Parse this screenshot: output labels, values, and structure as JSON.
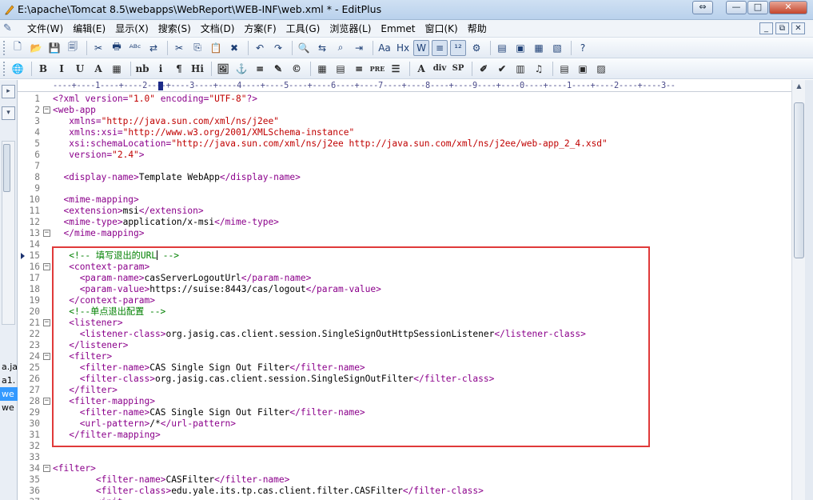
{
  "window": {
    "title": "E:\\apache\\Tomcat 8.5\\webapps\\WebReport\\WEB-INF\\web.xml * - EditPlus",
    "controls": {
      "minimize": "—",
      "maximize": "□",
      "close": "✕"
    },
    "restore_label": "⇔"
  },
  "menu": {
    "items": [
      "文件(W)",
      "编辑(E)",
      "显示(X)",
      "搜索(S)",
      "文档(D)",
      "方案(F)",
      "工具(G)",
      "浏览器(L)",
      "Emmet",
      "窗口(K)",
      "帮助"
    ],
    "mdi": {
      "minimize": "_",
      "restore": "⧉",
      "close": "✕"
    }
  },
  "toolbar1": {
    "icons": [
      "new-file-icon",
      "open-folder-icon",
      "save-icon",
      "save-all-icon",
      "cut-file-icon",
      "print-icon",
      "spellcheck-icon",
      "ftp-icon",
      "cut-icon",
      "copy-icon",
      "paste-icon",
      "delete-icon",
      "undo-icon",
      "redo-icon",
      "find-icon",
      "replace-icon",
      "find-in-files-icon",
      "goto-line-icon",
      "font-size-icon",
      "hex-icon",
      "word-wrap-icon",
      "ruler-icon",
      "line-number-icon",
      "settings-icon",
      "directory-icon",
      "clipboard-icon",
      "output-icon",
      "cliptext-icon",
      "help-icon"
    ],
    "glyphs": [
      "🗋",
      "📂",
      "💾",
      "🗐",
      "✂",
      "🖶",
      "ᴬᴮᶜ",
      "⇄",
      "✂",
      "⎘",
      "📋",
      "✖",
      "↶",
      "↷",
      "🔍",
      "⇆",
      "⌕",
      "⇥",
      "Aa",
      "Hx",
      "W",
      "≡",
      "¹²",
      "⚙",
      "▤",
      "▣",
      "▦",
      "▧",
      "?"
    ]
  },
  "toolbar2": {
    "items": [
      "🌐",
      "B",
      "I",
      "U",
      "A",
      "▦",
      "nb",
      "i",
      "¶",
      "Hi",
      "🖼",
      "⚓",
      "≡",
      "✎",
      "©",
      "▦",
      "▤",
      "≡",
      "PRE",
      "☰",
      "A",
      "div",
      "SP",
      "✐",
      "✔",
      "▥",
      "♫",
      "▤",
      "▣",
      "▨"
    ]
  },
  "left_panel": {
    "buttons": [
      "▸",
      "▾"
    ],
    "files": [
      {
        "name": "a.ja",
        "selected": false
      },
      {
        "name": "a1.",
        "selected": false
      },
      {
        "name": "we",
        "selected": true
      },
      {
        "name": "we",
        "selected": false
      }
    ]
  },
  "ruler": {
    "text": "----+----1----+----2----+----3----+----4----+----5----+----6----+----7----+----8----+----9----+----0----+----1----+----2----+----3--"
  },
  "editor": {
    "lines": [
      {
        "n": "1",
        "fold": "",
        "tokens": [
          [
            "t-tag",
            "<?xml "
          ],
          [
            "t-attr",
            "version="
          ],
          [
            "t-val",
            "\"1.0\" "
          ],
          [
            "t-attr",
            "encoding="
          ],
          [
            "t-val",
            "\"UTF-8\""
          ],
          [
            "t-tag",
            "?>"
          ]
        ]
      },
      {
        "n": "2",
        "fold": "⊟",
        "tokens": [
          [
            "t-tag",
            "<web-app"
          ]
        ]
      },
      {
        "n": "3",
        "fold": "",
        "tokens": [
          [
            "t-text",
            "   "
          ],
          [
            "t-attr",
            "xmlns="
          ],
          [
            "t-val",
            "\"http://java.sun.com/xml/ns/j2ee\""
          ]
        ]
      },
      {
        "n": "4",
        "fold": "",
        "tokens": [
          [
            "t-text",
            "   "
          ],
          [
            "t-attr",
            "xmlns:xsi="
          ],
          [
            "t-val",
            "\"http://www.w3.org/2001/XMLSchema-instance\""
          ]
        ]
      },
      {
        "n": "5",
        "fold": "",
        "tokens": [
          [
            "t-text",
            "   "
          ],
          [
            "t-attr",
            "xsi:schemaLocation="
          ],
          [
            "t-val",
            "\"http://java.sun.com/xml/ns/j2ee http://java.sun.com/xml/ns/j2ee/web-app_2_4.xsd\""
          ]
        ]
      },
      {
        "n": "6",
        "fold": "",
        "tokens": [
          [
            "t-text",
            "   "
          ],
          [
            "t-attr",
            "version="
          ],
          [
            "t-val",
            "\"2.4\""
          ],
          [
            "t-tag",
            ">"
          ]
        ]
      },
      {
        "n": "7",
        "fold": "",
        "tokens": []
      },
      {
        "n": "8",
        "fold": "",
        "tokens": [
          [
            "t-text",
            "  "
          ],
          [
            "t-tag",
            "<display-name>"
          ],
          [
            "t-text",
            "Template WebApp"
          ],
          [
            "t-tag",
            "</display-name>"
          ]
        ]
      },
      {
        "n": "9",
        "fold": "",
        "tokens": []
      },
      {
        "n": "10",
        "fold": "",
        "tokens": [
          [
            "t-text",
            "  "
          ],
          [
            "t-tag",
            "<mime-mapping>"
          ]
        ]
      },
      {
        "n": "11",
        "fold": "",
        "tokens": [
          [
            "t-text",
            "  "
          ],
          [
            "t-tag",
            "<extension>"
          ],
          [
            "t-text",
            "msi"
          ],
          [
            "t-tag",
            "</extension>"
          ]
        ]
      },
      {
        "n": "12",
        "fold": "",
        "tokens": [
          [
            "t-text",
            "  "
          ],
          [
            "t-tag",
            "<mime-type>"
          ],
          [
            "t-text",
            "application/x-msi"
          ],
          [
            "t-tag",
            "</mime-type>"
          ]
        ]
      },
      {
        "n": "13",
        "fold": "⊟",
        "tokens": [
          [
            "t-text",
            "  "
          ],
          [
            "t-tag",
            "</mime-mapping>"
          ]
        ]
      },
      {
        "n": "14",
        "fold": "",
        "tokens": []
      },
      {
        "n": "15",
        "fold": "",
        "marker": true,
        "tokens": [
          [
            "t-text",
            "   "
          ],
          [
            "t-comment",
            "<!-- 填写退出的URL"
          ],
          [
            "caret",
            ""
          ],
          [
            "t-comment",
            " -->"
          ]
        ]
      },
      {
        "n": "16",
        "fold": "⊟",
        "tokens": [
          [
            "t-text",
            "   "
          ],
          [
            "t-tag",
            "<context-param>"
          ]
        ]
      },
      {
        "n": "17",
        "fold": "",
        "tokens": [
          [
            "t-text",
            "     "
          ],
          [
            "t-tag",
            "<param-name>"
          ],
          [
            "t-text",
            "casServerLogoutUrl"
          ],
          [
            "t-tag",
            "</param-name>"
          ]
        ]
      },
      {
        "n": "18",
        "fold": "",
        "tokens": [
          [
            "t-text",
            "     "
          ],
          [
            "t-tag",
            "<param-value>"
          ],
          [
            "t-text",
            "https://suise:8443/cas/logout"
          ],
          [
            "t-tag",
            "</param-value>"
          ]
        ]
      },
      {
        "n": "19",
        "fold": "",
        "tokens": [
          [
            "t-text",
            "   "
          ],
          [
            "t-tag",
            "</context-param>"
          ]
        ]
      },
      {
        "n": "20",
        "fold": "",
        "tokens": [
          [
            "t-text",
            "   "
          ],
          [
            "t-comment",
            "<!--单点退出配置 -->"
          ]
        ]
      },
      {
        "n": "21",
        "fold": "⊟",
        "tokens": [
          [
            "t-text",
            "   "
          ],
          [
            "t-tag",
            "<listener>"
          ]
        ]
      },
      {
        "n": "22",
        "fold": "",
        "tokens": [
          [
            "t-text",
            "     "
          ],
          [
            "t-tag",
            "<listener-class>"
          ],
          [
            "t-text",
            "org.jasig.cas.client.session.SingleSignOutHttpSessionListener"
          ],
          [
            "t-tag",
            "</listener-class>"
          ]
        ]
      },
      {
        "n": "23",
        "fold": "",
        "tokens": [
          [
            "t-text",
            "   "
          ],
          [
            "t-tag",
            "</listener>"
          ]
        ]
      },
      {
        "n": "24",
        "fold": "⊟",
        "tokens": [
          [
            "t-text",
            "   "
          ],
          [
            "t-tag",
            "<filter>"
          ]
        ]
      },
      {
        "n": "25",
        "fold": "",
        "tokens": [
          [
            "t-text",
            "     "
          ],
          [
            "t-tag",
            "<filter-name>"
          ],
          [
            "t-text",
            "CAS Single Sign Out Filter"
          ],
          [
            "t-tag",
            "</filter-name>"
          ]
        ]
      },
      {
        "n": "26",
        "fold": "",
        "tokens": [
          [
            "t-text",
            "     "
          ],
          [
            "t-tag",
            "<filter-class>"
          ],
          [
            "t-text",
            "org.jasig.cas.client.session.SingleSignOutFilter"
          ],
          [
            "t-tag",
            "</filter-class>"
          ]
        ]
      },
      {
        "n": "27",
        "fold": "",
        "tokens": [
          [
            "t-text",
            "   "
          ],
          [
            "t-tag",
            "</filter>"
          ]
        ]
      },
      {
        "n": "28",
        "fold": "⊟",
        "tokens": [
          [
            "t-text",
            "   "
          ],
          [
            "t-tag",
            "<filter-mapping>"
          ]
        ]
      },
      {
        "n": "29",
        "fold": "",
        "tokens": [
          [
            "t-text",
            "     "
          ],
          [
            "t-tag",
            "<filter-name>"
          ],
          [
            "t-text",
            "CAS Single Sign Out Filter"
          ],
          [
            "t-tag",
            "</filter-name>"
          ]
        ]
      },
      {
        "n": "30",
        "fold": "",
        "tokens": [
          [
            "t-text",
            "     "
          ],
          [
            "t-tag",
            "<url-pattern>"
          ],
          [
            "t-text",
            "/*"
          ],
          [
            "t-tag",
            "</url-pattern>"
          ]
        ]
      },
      {
        "n": "31",
        "fold": "",
        "tokens": [
          [
            "t-text",
            "   "
          ],
          [
            "t-tag",
            "</filter-mapping>"
          ]
        ]
      },
      {
        "n": "32",
        "fold": "",
        "tokens": []
      },
      {
        "n": "33",
        "fold": "",
        "tokens": []
      },
      {
        "n": "34",
        "fold": "⊟",
        "tokens": [
          [
            "t-tag",
            "<filter>"
          ]
        ]
      },
      {
        "n": "35",
        "fold": "",
        "tokens": [
          [
            "t-text",
            "        "
          ],
          [
            "t-tag",
            "<filter-name>"
          ],
          [
            "t-text",
            "CASFilter"
          ],
          [
            "t-tag",
            "</filter-name>"
          ]
        ]
      },
      {
        "n": "36",
        "fold": "",
        "tokens": [
          [
            "t-text",
            "        "
          ],
          [
            "t-tag",
            "<filter-class>"
          ],
          [
            "t-text",
            "edu.yale.its.tp.cas.client.filter.CASFilter"
          ],
          [
            "t-tag",
            "</filter-class>"
          ]
        ]
      },
      {
        "n": "37",
        "fold": "",
        "tokens": [
          [
            "t-text",
            "        "
          ],
          [
            "t-tag",
            "<init-"
          ]
        ]
      }
    ]
  },
  "colors": {
    "tag": "#8b008b",
    "value": "#c00000",
    "comment": "#008000",
    "highlight_box": "#e03a3a",
    "selected_file": "#3399ff"
  }
}
